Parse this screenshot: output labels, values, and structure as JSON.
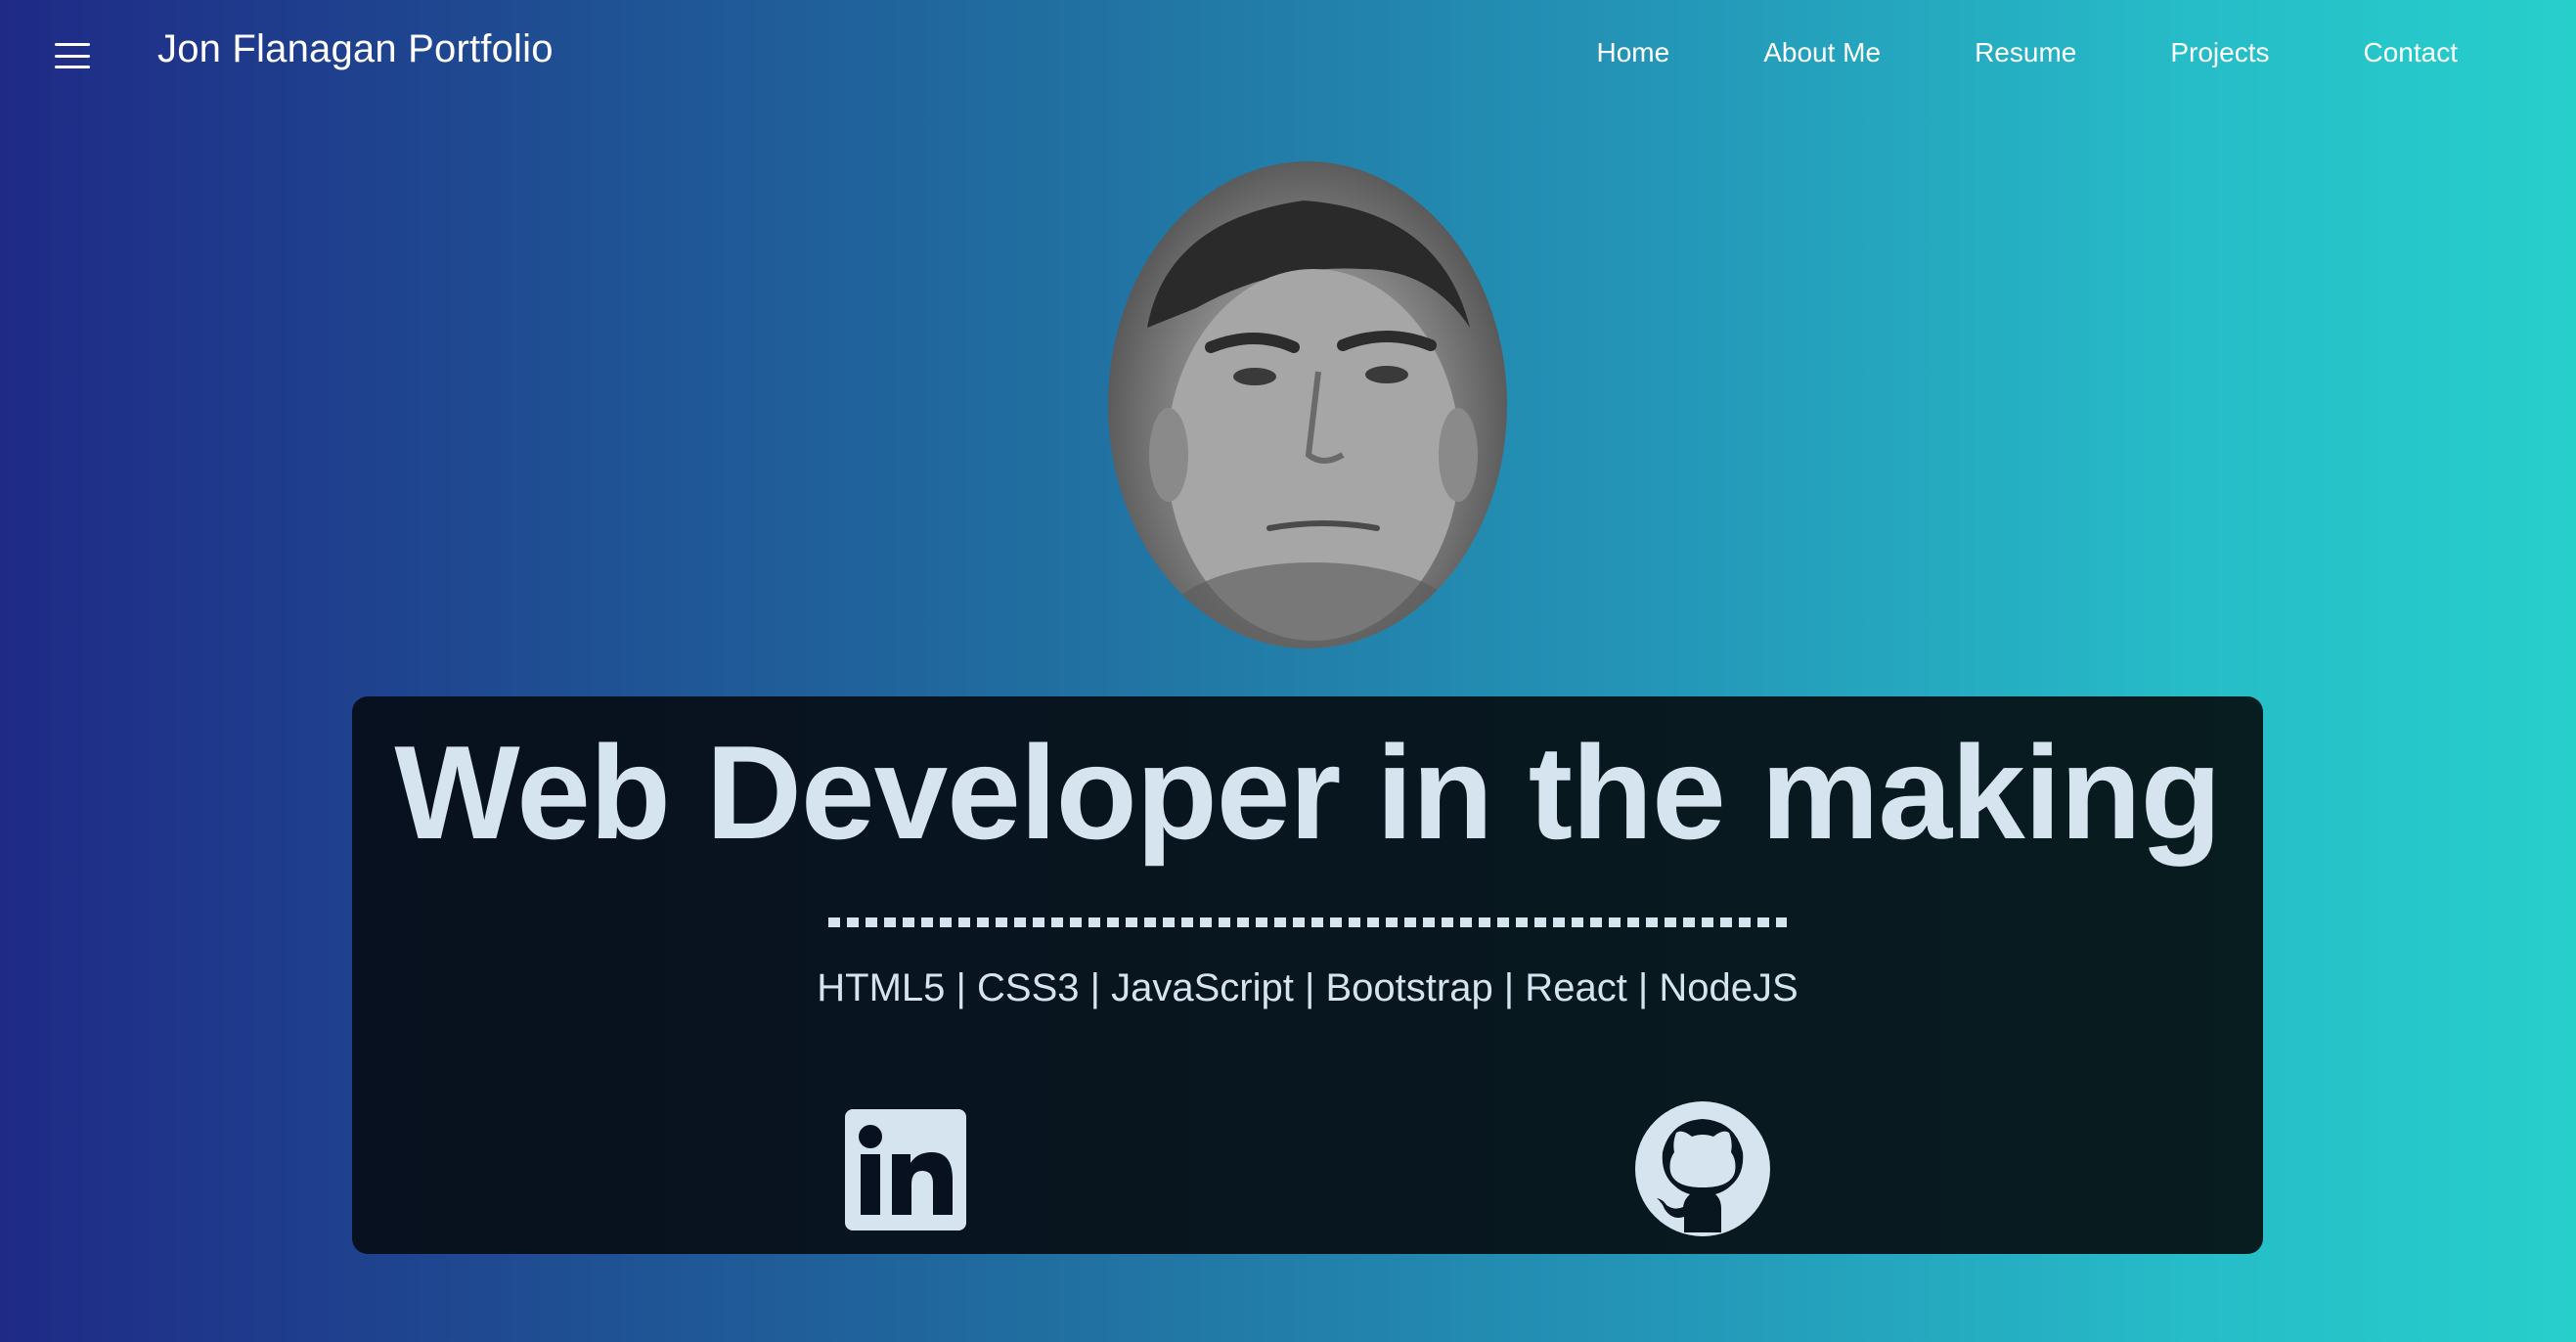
{
  "header": {
    "brand": "Jon Flanagan Portfolio",
    "menu_icon": "hamburger-menu-icon",
    "nav": [
      {
        "label": "Home"
      },
      {
        "label": "About Me"
      },
      {
        "label": "Resume"
      },
      {
        "label": "Projects"
      },
      {
        "label": "Contact"
      }
    ]
  },
  "hero": {
    "avatar_alt": "profile-photo",
    "title": "Web Developer in the making",
    "skills": "HTML5 | CSS3 | JavaScript | Bootstrap | React | NodeJS",
    "social": [
      {
        "icon": "linkedin-icon"
      },
      {
        "icon": "github-icon"
      }
    ]
  },
  "colors": {
    "gradient_start": "#1f2a86",
    "gradient_end": "#27cfcb",
    "card_bg": "#08161f",
    "card_text": "#d6e4f0"
  }
}
